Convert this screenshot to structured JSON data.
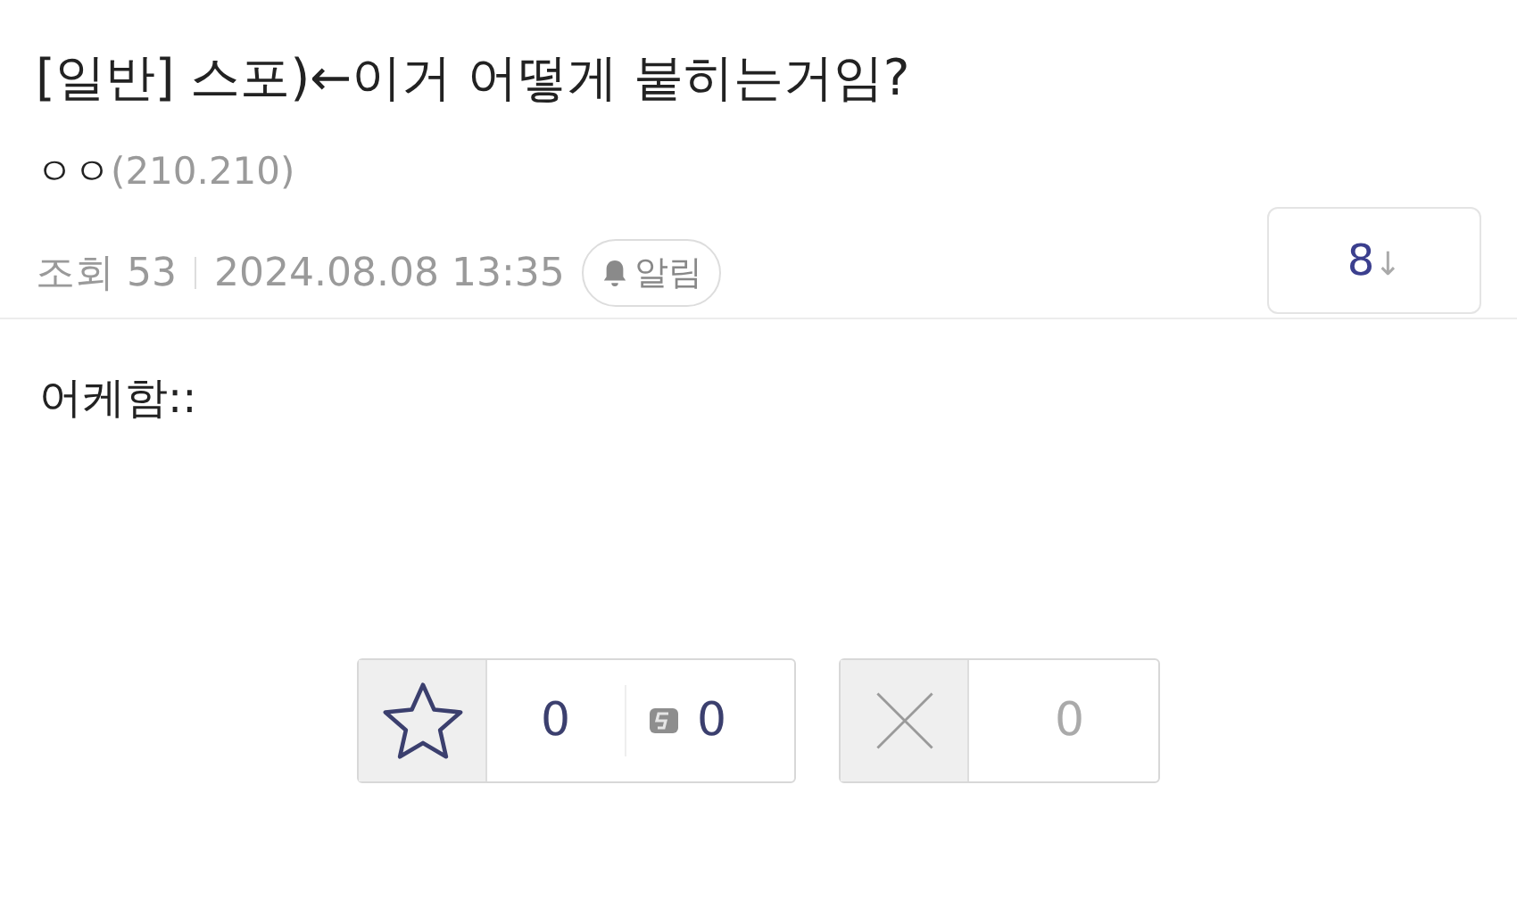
{
  "post": {
    "title": "[일반] 스포)←이거 어떻게 붙히는거임?",
    "author": "ㅇㅇ",
    "ip": "(210.210)",
    "views": "조회 53",
    "date": "2024.08.08 13:35",
    "alarm": "알림",
    "comments": "8",
    "comments_arrow": "↓",
    "body": "어케함::"
  },
  "votes": {
    "up": "0",
    "fixed_up": "0",
    "down": "0"
  }
}
